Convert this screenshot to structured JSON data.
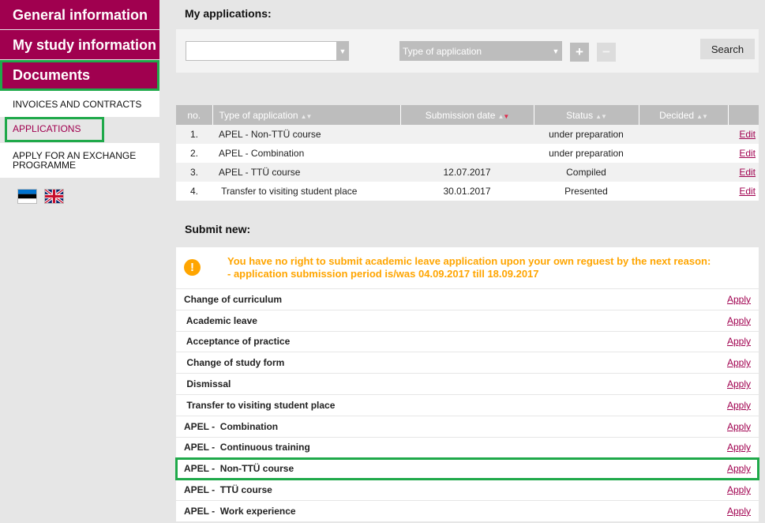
{
  "sidebar": {
    "main_items": [
      "General information",
      "My study information",
      "Documents"
    ],
    "sub_items": [
      "INVOICES AND CONTRACTS",
      "APPLICATIONS",
      "APPLY FOR AN EXCHANGE PROGRAMME"
    ]
  },
  "applications": {
    "title": "My applications:",
    "type_placeholder": "Type of application",
    "search_label": "Search",
    "plus_label": "+",
    "minus_label": "−",
    "columns": [
      "no.",
      "Type of application",
      "Submission date",
      "Status",
      "Decided",
      ""
    ],
    "rows": [
      {
        "no": "1.",
        "type": "APEL -  Non-TTÜ course",
        "date": "",
        "status": "under preparation",
        "decided": "",
        "action": "Edit"
      },
      {
        "no": "2.",
        "type": "APEL -  Combination",
        "date": "",
        "status": "under preparation",
        "decided": "",
        "action": "Edit"
      },
      {
        "no": "3.",
        "type": "APEL -  TTÜ course",
        "date": "12.07.2017",
        "status": "Compiled",
        "decided": "",
        "action": "Edit"
      },
      {
        "no": "4.",
        "type": " Transfer to visiting student place",
        "date": "30.01.2017",
        "status": "Presented",
        "decided": "",
        "action": "Edit"
      }
    ]
  },
  "submit": {
    "title": "Submit new:",
    "warning_line1": "You have no right to submit academic leave application upon your own reguest by the next reason:",
    "warning_line2": "- application submission period is/was 04.09.2017 till 18.09.2017",
    "apply_label": "Apply",
    "items": [
      "Change of curriculum",
      " Academic leave",
      " Acceptance of practice",
      " Change of study form",
      " Dismissal",
      " Transfer to visiting student place",
      "APEL -  Combination",
      "APEL -  Continuous training",
      "APEL -  Non-TTÜ course",
      "APEL -  TTÜ course",
      "APEL -  Work experience"
    ]
  },
  "colors": {
    "brand": "#a0004f",
    "highlight": "#1fa94a",
    "warning": "#ffa500"
  }
}
